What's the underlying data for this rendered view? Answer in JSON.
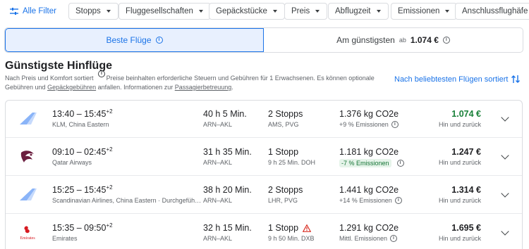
{
  "filters": {
    "all_filter": "Alle Filter",
    "chips": [
      "Stopps",
      "Fluggesellschaften",
      "Gepäckstücke",
      "Preis",
      "Abflugzeit",
      "Emissionen",
      "Anschlussflughäfe"
    ]
  },
  "tabs": {
    "best": "Beste Flüge",
    "cheapest": "Am günstigsten",
    "cheapest_prefix": "ab",
    "cheapest_price": "1.074 €"
  },
  "section": {
    "title": "Günstigste Hinflüge",
    "desc_part1": "Nach Preis und Komfort sortiert",
    "desc_part2": "Preise beinhalten erforderliche Steuern und Gebühren für 1 Erwachsenen. Es können optionale Gebühren und",
    "desc_link1": "Gepäckgebühren",
    "desc_part3": "anfallen. Informationen zur",
    "desc_link2": "Passagierbetreuung",
    "desc_part4": ".",
    "sort_label": "Nach beliebtesten Flügen sortiert"
  },
  "flights": [
    {
      "times": "13:40 – 15:45",
      "plus": "+2",
      "airline": "KLM, China Eastern",
      "duration": "40 h 5 Min.",
      "route": "ARN–AKL",
      "stops": "2 Stopps",
      "stop_detail": "AMS, PVG",
      "co2": "1.376 kg CO2e",
      "emissions": "+9 % Emissionen",
      "price": "1.074 €",
      "trip": "Hin und zurück",
      "logo": "china-eastern-logo"
    },
    {
      "times": "09:10 – 02:45",
      "plus": "+2",
      "airline": "Qatar Airways",
      "duration": "31 h 35 Min.",
      "route": "ARN–AKL",
      "stops": "1 Stopp",
      "stop_detail": "9 h 25 Min. DOH",
      "co2": "1.181 kg CO2e",
      "emissions": "-7 % Emissionen",
      "price": "1.247 €",
      "trip": "Hin und zurück",
      "logo": "qatar-logo"
    },
    {
      "times": "15:25 – 15:45",
      "plus": "+2",
      "airline": "Scandinavian Airlines, China Eastern · Durchgeführt von",
      "duration": "38 h 20 Min.",
      "route": "ARN–AKL",
      "stops": "2 Stopps",
      "stop_detail": "LHR, PVG",
      "co2": "1.441 kg CO2e",
      "emissions": "+14 % Emissionen",
      "price": "1.314 €",
      "trip": "Hin und zurück",
      "logo": "china-eastern-logo"
    },
    {
      "times": "15:35 – 09:50",
      "plus": "+2",
      "airline": "Emirates",
      "duration": "32 h 15 Min.",
      "route": "ARN–AKL",
      "stops": "1 Stopp",
      "stop_detail": "9 h 50 Min. DXB",
      "co2": "1.291 kg CO2e",
      "emissions": "Mittl. Emissionen",
      "price": "1.695 €",
      "trip": "Hin und zurück",
      "logo": "emirates-logo",
      "logo_text": "Emirates"
    }
  ],
  "colors": {
    "accent": "#1a73e8",
    "cheap_price": "#188038",
    "good_emission": "#137333",
    "warning": "#d93025"
  }
}
